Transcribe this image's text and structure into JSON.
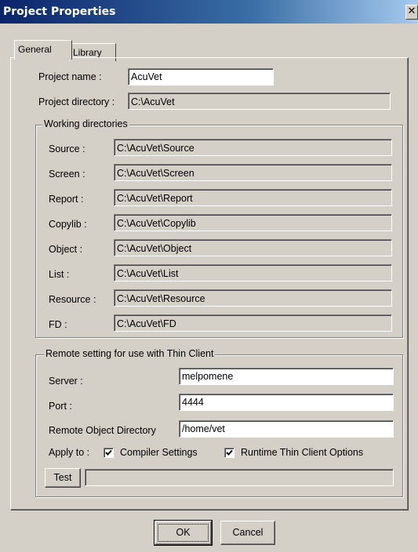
{
  "window": {
    "title": "Project Properties",
    "close_glyph": "✕"
  },
  "tabs": [
    {
      "label": "General"
    },
    {
      "label": "Library"
    }
  ],
  "general": {
    "project_name_label": "Project name :",
    "project_name_value": "AcuVet",
    "project_dir_label": "Project directory :",
    "project_dir_value": "C:\\AcuVet"
  },
  "working": {
    "legend": "Working directories",
    "rows": [
      {
        "label": "Source :",
        "value": "C:\\AcuVet\\Source"
      },
      {
        "label": "Screen :",
        "value": "C:\\AcuVet\\Screen"
      },
      {
        "label": "Report :",
        "value": "C:\\AcuVet\\Report"
      },
      {
        "label": "Copylib :",
        "value": "C:\\AcuVet\\Copylib"
      },
      {
        "label": "Object :",
        "value": "C:\\AcuVet\\Object"
      },
      {
        "label": "List :",
        "value": "C:\\AcuVet\\List"
      },
      {
        "label": "Resource :",
        "value": "C:\\AcuVet\\Resource"
      },
      {
        "label": "FD :",
        "value": "C:\\AcuVet\\FD"
      }
    ]
  },
  "remote": {
    "legend": "Remote setting for use with Thin Client",
    "server_label": "Server :",
    "server_value": "melpomene",
    "port_label": "Port :",
    "port_value": "4444",
    "objdir_label": "Remote Object Directory",
    "objdir_value": "/home/vet",
    "apply_label": "Apply to :",
    "compiler_label": "Compiler Settings",
    "compiler_checked": true,
    "runtime_label": "Runtime Thin Client Options",
    "runtime_checked": true,
    "test_label": "Test",
    "test_result": ""
  },
  "buttons": {
    "ok": "OK",
    "cancel": "Cancel"
  }
}
